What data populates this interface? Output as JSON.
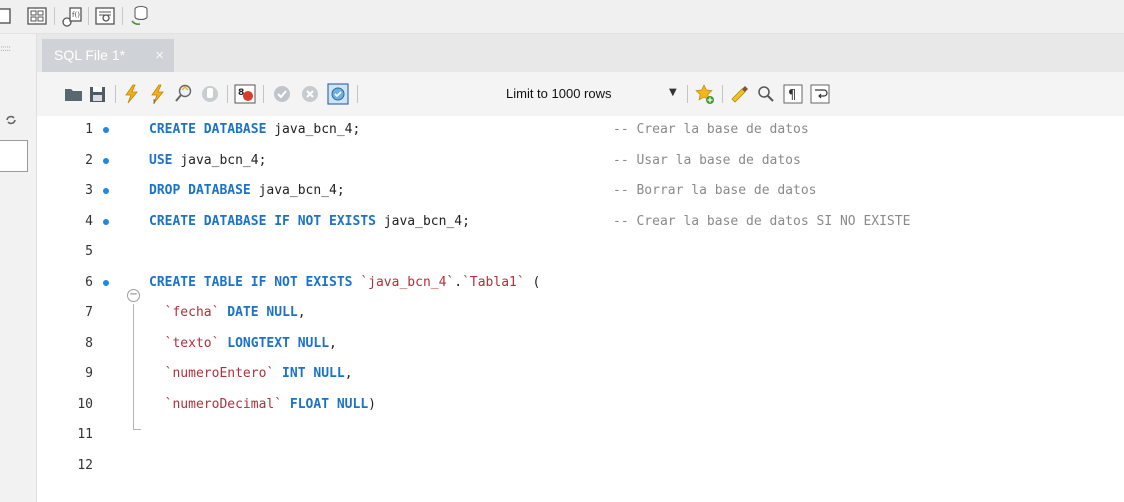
{
  "tab": {
    "title": "SQL File 1*",
    "close": "×"
  },
  "limit": {
    "label": "Limit to 1000 rows"
  },
  "editor": {
    "lines": [
      {
        "num": "1",
        "dot": true,
        "tokens": [
          {
            "t": "kw",
            "v": "CREATE DATABASE "
          },
          {
            "t": "idf",
            "v": "java_bcn_4;"
          }
        ],
        "comment": "-- Crear la base de datos"
      },
      {
        "num": "2",
        "dot": true,
        "tokens": [
          {
            "t": "kw",
            "v": "USE "
          },
          {
            "t": "idf",
            "v": "java_bcn_4;"
          }
        ],
        "comment": "-- Usar la base de datos"
      },
      {
        "num": "3",
        "dot": true,
        "tokens": [
          {
            "t": "kw",
            "v": "DROP DATABASE "
          },
          {
            "t": "idf",
            "v": "java_bcn_4;"
          }
        ],
        "comment": "-- Borrar la base de datos"
      },
      {
        "num": "4",
        "dot": true,
        "tokens": [
          {
            "t": "kw",
            "v": "CREATE DATABASE IF NOT EXISTS "
          },
          {
            "t": "idf",
            "v": "java_bcn_4;"
          }
        ],
        "comment": "-- Crear la base de datos SI NO EXISTE"
      },
      {
        "num": "5",
        "dot": false,
        "tokens": [],
        "comment": ""
      },
      {
        "num": "6",
        "dot": true,
        "tokens": [
          {
            "t": "kw",
            "v": "CREATE TABLE IF NOT EXISTS "
          },
          {
            "t": "str",
            "v": "`java_bcn_4`"
          },
          {
            "t": "idf",
            "v": "."
          },
          {
            "t": "str",
            "v": "`Tabla1`"
          },
          {
            "t": "idf",
            "v": " ("
          }
        ],
        "comment": ""
      },
      {
        "num": "7",
        "dot": false,
        "tokens": [
          {
            "t": "idf",
            "v": "  "
          },
          {
            "t": "str",
            "v": "`fecha`"
          },
          {
            "t": "kw",
            "v": " DATE NULL"
          },
          {
            "t": "idf",
            "v": ","
          }
        ],
        "comment": ""
      },
      {
        "num": "8",
        "dot": false,
        "tokens": [
          {
            "t": "idf",
            "v": "  "
          },
          {
            "t": "str",
            "v": "`texto`"
          },
          {
            "t": "kw",
            "v": " LONGTEXT NULL"
          },
          {
            "t": "idf",
            "v": ","
          }
        ],
        "comment": ""
      },
      {
        "num": "9",
        "dot": false,
        "tokens": [
          {
            "t": "idf",
            "v": "  "
          },
          {
            "t": "str",
            "v": "`numeroEntero`"
          },
          {
            "t": "kw",
            "v": " INT NULL"
          },
          {
            "t": "idf",
            "v": ","
          }
        ],
        "comment": ""
      },
      {
        "num": "10",
        "dot": false,
        "tokens": [
          {
            "t": "idf",
            "v": "  "
          },
          {
            "t": "str",
            "v": "`numeroDecimal`"
          },
          {
            "t": "kw",
            "v": " FLOAT NULL"
          },
          {
            "t": "idf",
            "v": ")"
          }
        ],
        "comment": ""
      },
      {
        "num": "11",
        "dot": false,
        "tokens": [],
        "comment": ""
      },
      {
        "num": "12",
        "dot": false,
        "tokens": [],
        "comment": ""
      }
    ]
  },
  "icons": {
    "top_toolbar": [
      "table-inspect-icon",
      "create-schema-icon",
      "create-function-icon",
      "inspector-icon",
      "reconnect-icon"
    ],
    "editor_toolbar": [
      "open-file-icon",
      "save-icon",
      "execute-icon",
      "execute-current-icon",
      "explain-icon",
      "stop-icon",
      "toggle-error-icon",
      "commit-icon",
      "rollback-icon",
      "autocommit-icon",
      "add-snippet-icon",
      "beautify-icon",
      "find-icon",
      "invisible-chars-icon",
      "word-wrap-icon"
    ]
  }
}
